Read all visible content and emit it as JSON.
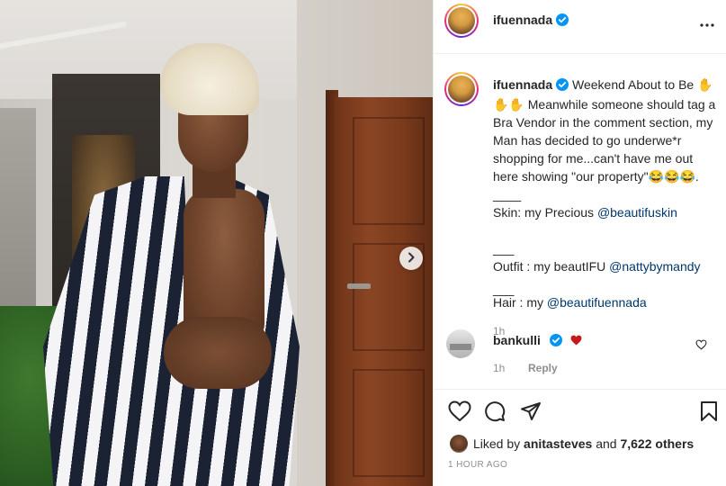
{
  "post": {
    "username": "ifuennada",
    "verified": true
  },
  "caption": {
    "username": "ifuennada",
    "text_line1": "Weekend About to Be ✋✋✋ Meanwhile someone should tag a Bra Vendor in the comment section, my Man has decided to go underwe*r shopping for me...can't have me out here showing \"our property\"😂😂😂.",
    "sep1": "____",
    "skin_label": "Skin: my Precious ",
    "skin_mention": "@beautifuskin",
    "sep2": "___",
    "outfit_label": "Outfit : my beautIFU ",
    "outfit_mention": "@nattybymandy",
    "sep3": "___",
    "hair_label": "Hair : my ",
    "hair_mention": "@beautifuennada",
    "time": "1h"
  },
  "comment": {
    "username": "bankulli",
    "time": "1h",
    "reply_label": "Reply"
  },
  "likes": {
    "prefix": "Liked by ",
    "liker": "anitasteves",
    "middle": " and ",
    "count_label": "7,622 others"
  },
  "posted_ago": "1 HOUR AGO",
  "colors": {
    "verified_blue": "#0095f6",
    "mention": "#00376b",
    "secondary_text": "#8e8e8e",
    "heart_red": "#c5191c"
  },
  "icons": {
    "next": "chevron-right-icon",
    "more": "more-horizontal-icon",
    "like": "heart-icon",
    "comment": "comment-icon",
    "share": "paper-plane-icon",
    "save": "bookmark-icon"
  }
}
